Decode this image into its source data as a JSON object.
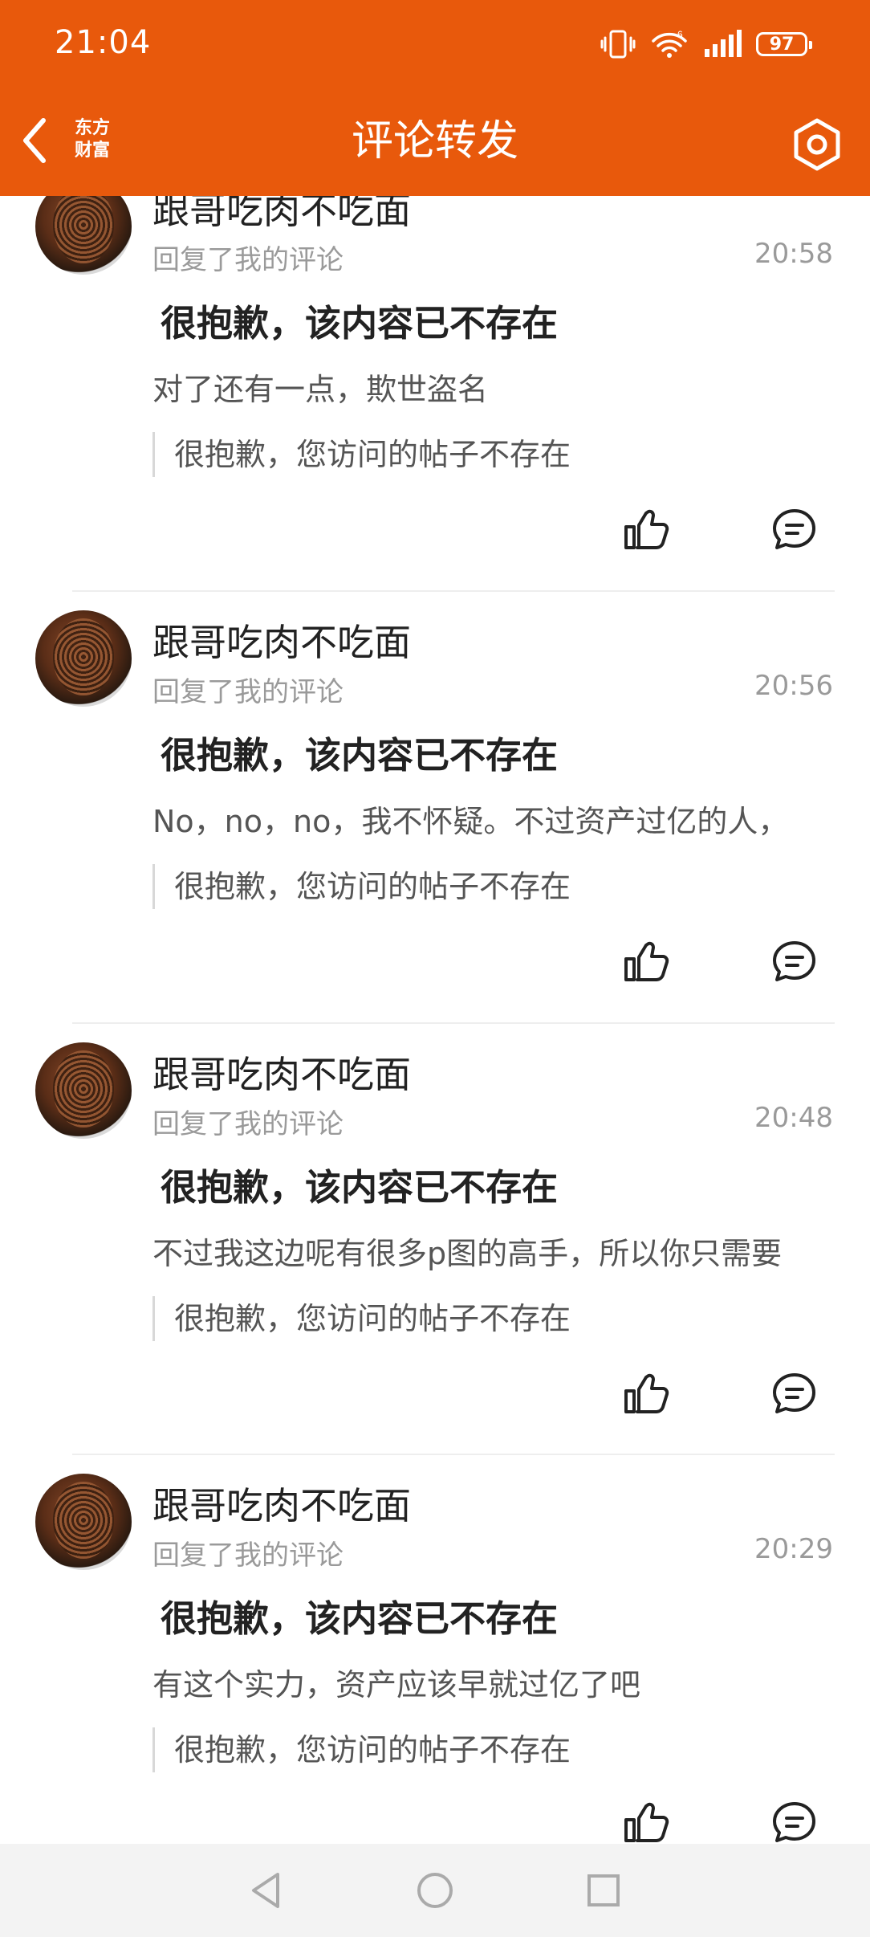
{
  "status_bar": {
    "time": "21:04",
    "battery": "97",
    "network": "6"
  },
  "header": {
    "title": "评论转发",
    "logo_line1": "东方",
    "logo_line2": "财富",
    "back_icon": "chevron-left-icon",
    "settings_icon": "gear-icon"
  },
  "comments": [
    {
      "author": "跟哥吃肉不吃面",
      "subtext": "回复了我的评论",
      "time": "20:58",
      "deleted": "很抱歉，该内容已不存在",
      "comment": "对了还有一点，欺世盗名",
      "quote": "很抱歉，您访问的帖子不存在"
    },
    {
      "author": "跟哥吃肉不吃面",
      "subtext": "回复了我的评论",
      "time": "20:56",
      "deleted": "很抱歉，该内容已不存在",
      "comment": "No，no，no，我不怀疑。不过资产过亿的人，",
      "quote": "很抱歉，您访问的帖子不存在"
    },
    {
      "author": "跟哥吃肉不吃面",
      "subtext": "回复了我的评论",
      "time": "20:48",
      "deleted": "很抱歉，该内容已不存在",
      "comment": "不过我这边呢有很多p图的高手，所以你只需要",
      "quote": "很抱歉，您访问的帖子不存在"
    },
    {
      "author": "跟哥吃肉不吃面",
      "subtext": "回复了我的评论",
      "time": "20:29",
      "deleted": "很抱歉，该内容已不存在",
      "comment": "有这个实力，资产应该早就过亿了吧",
      "quote": "很抱歉，您访问的帖子不存在"
    }
  ],
  "nav": {
    "back": "triangle-back-icon",
    "home": "circle-home-icon",
    "recents": "square-recents-icon"
  },
  "colors": {
    "brand": "#E8590C"
  }
}
